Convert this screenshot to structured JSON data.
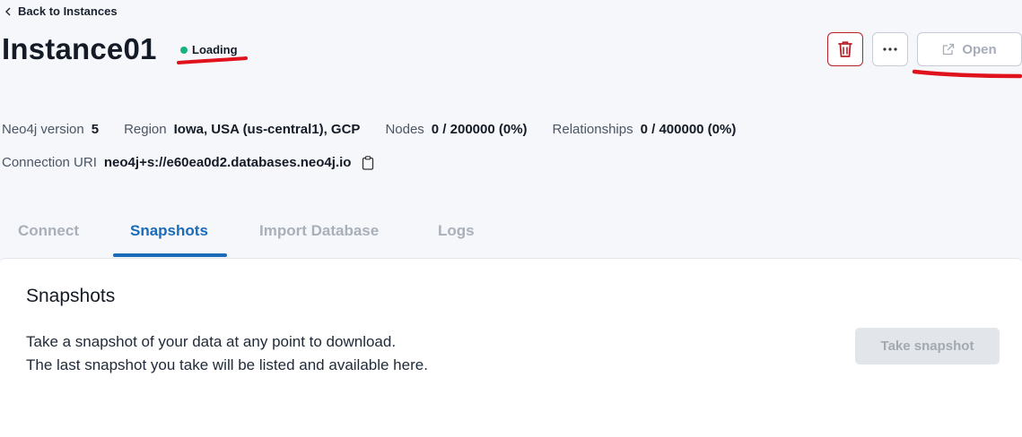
{
  "header": {
    "back_label": "Back to Instances",
    "title": "Instance01",
    "status": "Loading",
    "status_color": "#18b37c",
    "open_label": "Open"
  },
  "details": {
    "version_label": "Neo4j version",
    "version_value": "5",
    "region_label": "Region",
    "region_value": "Iowa, USA (us-central1), GCP",
    "nodes_label": "Nodes",
    "nodes_value": "0 / 200000 (0%)",
    "relationships_label": "Relationships",
    "relationships_value": "0 / 400000 (0%)",
    "uri_label": "Connection URI",
    "uri_value": "neo4j+s://e60ea0d2.databases.neo4j.io"
  },
  "tabs": [
    {
      "label": "Connect",
      "active": false
    },
    {
      "label": "Snapshots",
      "active": true
    },
    {
      "label": "Import Database",
      "active": false
    },
    {
      "label": "Logs",
      "active": false
    }
  ],
  "snapshots": {
    "title": "Snapshots",
    "line1": "Take a snapshot of your data at any point to download.",
    "line2": "The last snapshot you take will be listed and available here.",
    "button_label": "Take snapshot"
  },
  "icons": {
    "back": "chevron-left-icon",
    "delete": "trash-icon",
    "more": "ellipsis-icon",
    "open": "external-link-icon",
    "copy": "clipboard-icon"
  },
  "colors": {
    "accent": "#1a6bb8",
    "danger": "#b9202a",
    "annotation": "#e0121b"
  }
}
